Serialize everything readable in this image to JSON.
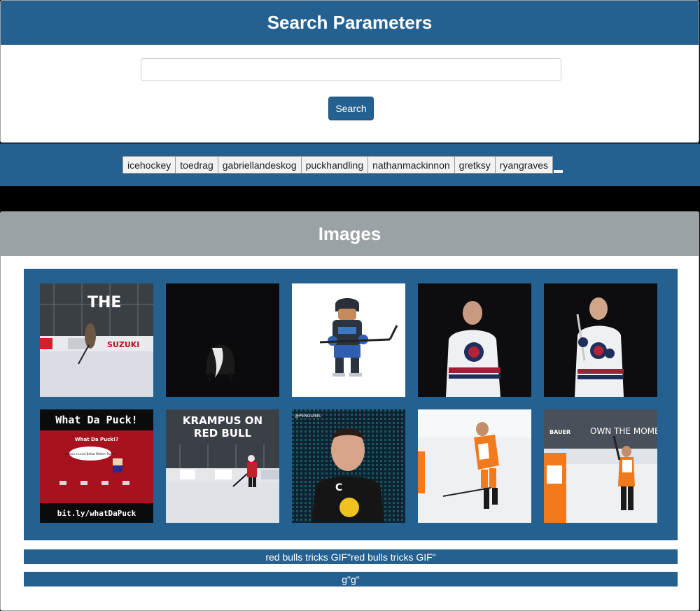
{
  "search_panel": {
    "title": "Search Parameters",
    "input_value": "",
    "input_placeholder": "",
    "button_label": "Search"
  },
  "tags": [
    "icehockey",
    "toedrag",
    "gabriellandeskog",
    "puckhandling",
    "nathanmackinnon",
    "gretksy",
    "ryangraves"
  ],
  "images_panel": {
    "title": "Images",
    "thumb_texts": {
      "t1_overlay": "THE",
      "t1_board1": "SUZUKI",
      "t6_title": "What Da Puck!",
      "t6_sub": "What Da Puck!?",
      "t6_bubble": "Choose a Level Below Mother Pucker",
      "t6_link": "bit.ly/whatDaPuck",
      "t7_title1": "KRAMPUS ON",
      "t7_title2": "RED BULL",
      "t8_tag": "@PENGUINS",
      "t8_jersey": "C",
      "t10_title": "OWN THE MOMENT",
      "t10_brand": "BAUER"
    },
    "captions": [
      "red bulls tricks GIF\"red bulls tricks GIF\"",
      "g\"g\""
    ]
  },
  "colors": {
    "primary": "#246190",
    "secondary_header": "#9ba2a6",
    "background": "#000000"
  }
}
